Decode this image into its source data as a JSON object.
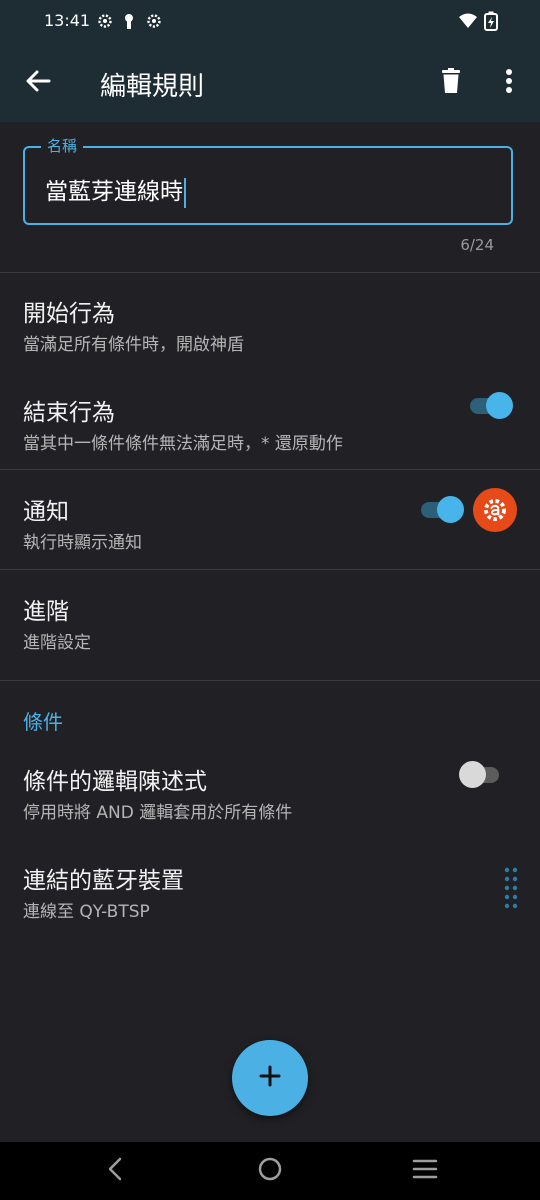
{
  "status_bar": {
    "time": "13:41"
  },
  "app_bar": {
    "title": "編輯規則"
  },
  "name_field": {
    "label": "名稱",
    "value": "當藍芽連線時",
    "counter": "6/24"
  },
  "rows": {
    "start_action": {
      "title": "開始行為",
      "subtitle": "當滿足所有條件時，開啟神盾"
    },
    "end_action": {
      "title": "結束行為",
      "subtitle": "當其中一條件條件無法滿足時，* 還原動作",
      "toggle": true
    },
    "notification": {
      "title": "通知",
      "subtitle": "執行時顯示通知",
      "toggle": true
    },
    "advanced": {
      "title": "進階",
      "subtitle": "進階設定"
    }
  },
  "conditions": {
    "header": "條件",
    "logic": {
      "title": "條件的邏輯陳述式",
      "subtitle": "停用時將 AND 邏輯套用於所有條件",
      "toggle": false
    },
    "bluetooth": {
      "title": "連結的藍牙裝置",
      "subtitle": "連線至 QY-BTSP"
    }
  },
  "colors": {
    "accent": "#4BB1E5",
    "app_bar": "#1E2D34",
    "background": "#212125",
    "badge": "#E64A19"
  },
  "icons": [
    "gear-icon",
    "keyhole-icon",
    "settings-icon",
    "wifi-icon",
    "battery-charging-icon",
    "back-arrow-icon",
    "trash-icon",
    "more-vert-icon",
    "app-badge-icon",
    "drag-handle-icon",
    "plus-icon",
    "nav-back-icon",
    "nav-home-icon",
    "nav-recents-icon"
  ]
}
